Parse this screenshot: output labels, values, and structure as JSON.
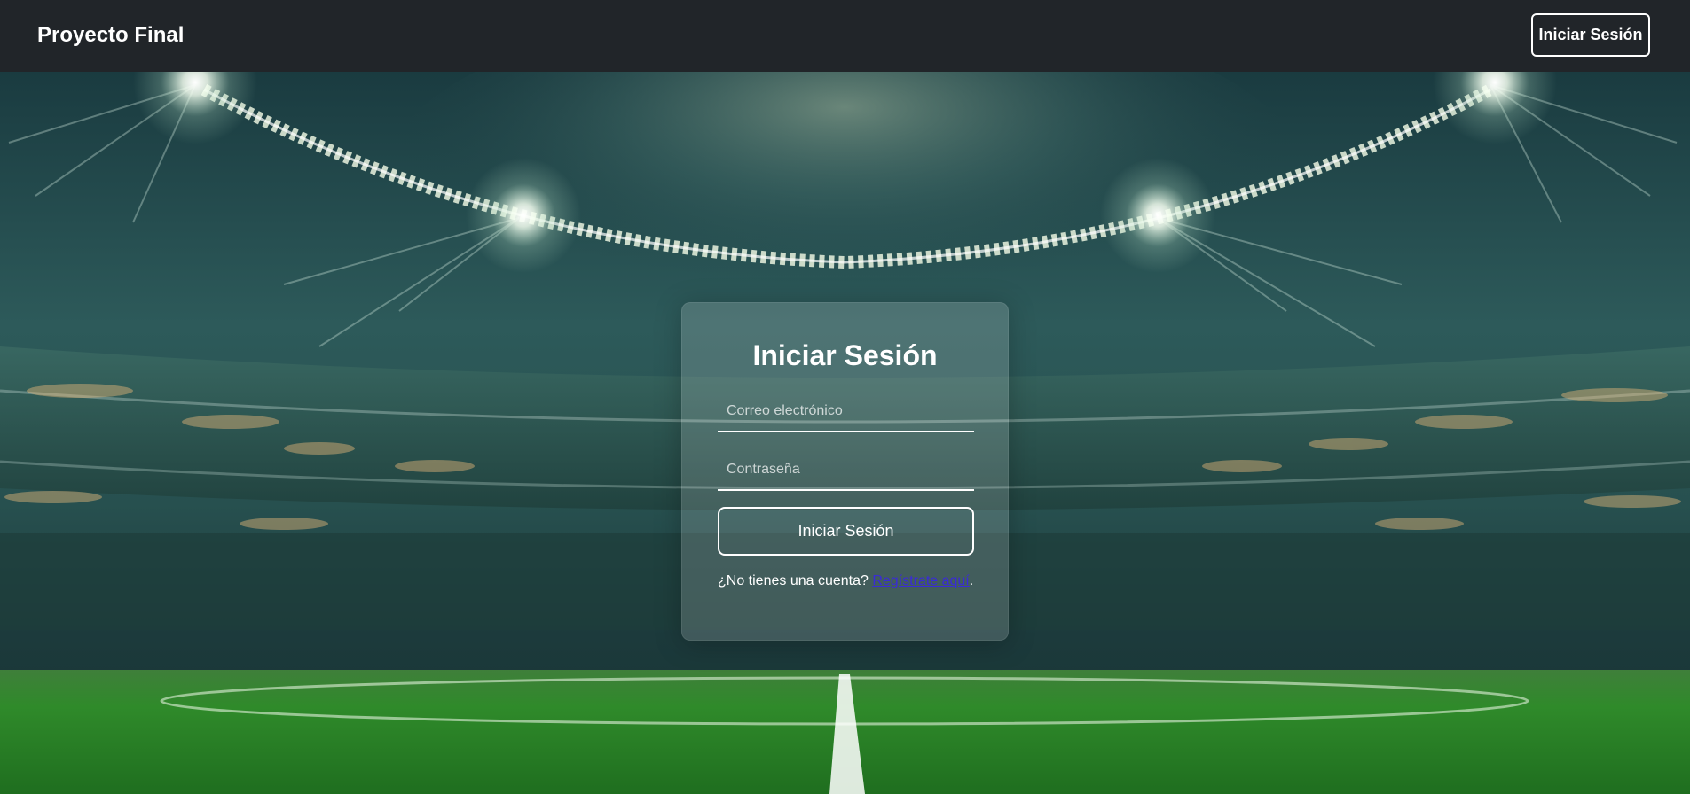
{
  "navbar": {
    "brand": "Proyecto Final",
    "login_button": "Iniciar Sesión"
  },
  "login_card": {
    "title": "Iniciar Sesión",
    "email_placeholder": "Correo electrónico",
    "email_value": "",
    "password_placeholder": "Contraseña",
    "password_value": "",
    "submit_label": "Iniciar Sesión",
    "register_prompt": "¿No tienes una cuenta?",
    "register_link": "Regístrate aquí",
    "register_suffix": "."
  },
  "colors": {
    "navbar_bg": "#212529",
    "link": "#3a2bd6",
    "pitch_green": "#2f8a2a"
  },
  "background": {
    "scene": "stadium-illustration"
  }
}
